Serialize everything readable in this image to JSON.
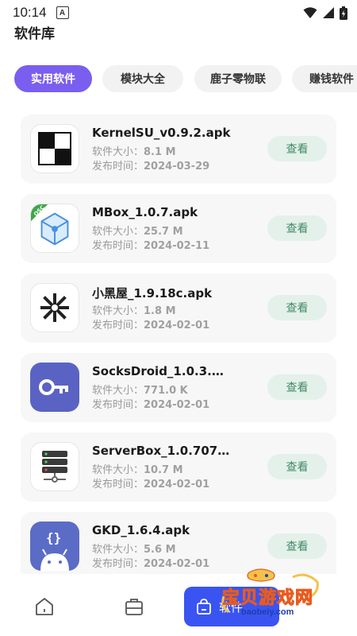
{
  "status_bar": {
    "time": "10:14",
    "notification_letter": "A"
  },
  "page": {
    "title": "软件库"
  },
  "tabs": [
    {
      "label": "实用软件",
      "active": true
    },
    {
      "label": "模块大全",
      "active": false
    },
    {
      "label": "鹿子零物联",
      "active": false
    },
    {
      "label": "赚钱软件",
      "active": false
    }
  ],
  "labels": {
    "size_prefix": "软件大小：",
    "date_prefix": "发布时间："
  },
  "apps": [
    {
      "name": "KernelSU_v0.9.2.apk",
      "size": "8.1 M",
      "date": "2024-03-29",
      "button": "查看",
      "icon": "kernelsu-icon"
    },
    {
      "name": "MBox_1.0.7.apk",
      "size": "25.7 M",
      "date": "2024-02-11",
      "button": "查看",
      "icon": "mbox-cube-icon"
    },
    {
      "name": "小黑屋_1.9.18c.apk",
      "size": "1.8 M",
      "date": "2024-02-01",
      "button": "查看",
      "icon": "snowflake-icon"
    },
    {
      "name": "SocksDroid_1.0.3.…",
      "size": "771.0 K",
      "date": "2024-02-01",
      "button": "查看",
      "icon": "key-icon"
    },
    {
      "name": "ServerBox_1.0.707…",
      "size": "10.7 M",
      "date": "2024-02-01",
      "button": "查看",
      "icon": "server-icon"
    },
    {
      "name": "GKD_1.6.4.apk",
      "size": "5.6 M",
      "date": "2024-02-01",
      "button": "查看",
      "icon": "android-braces-icon"
    }
  ],
  "bottom_nav": {
    "active_label": "软件"
  },
  "watermark": {
    "title": "宝贝游戏网",
    "url": "baobeiy.com"
  },
  "colors": {
    "accent": "#7a5ef0",
    "nav_active": "#3a54f2",
    "view_button_bg": "#e4f1ea",
    "view_button_text": "#3f8a63"
  }
}
